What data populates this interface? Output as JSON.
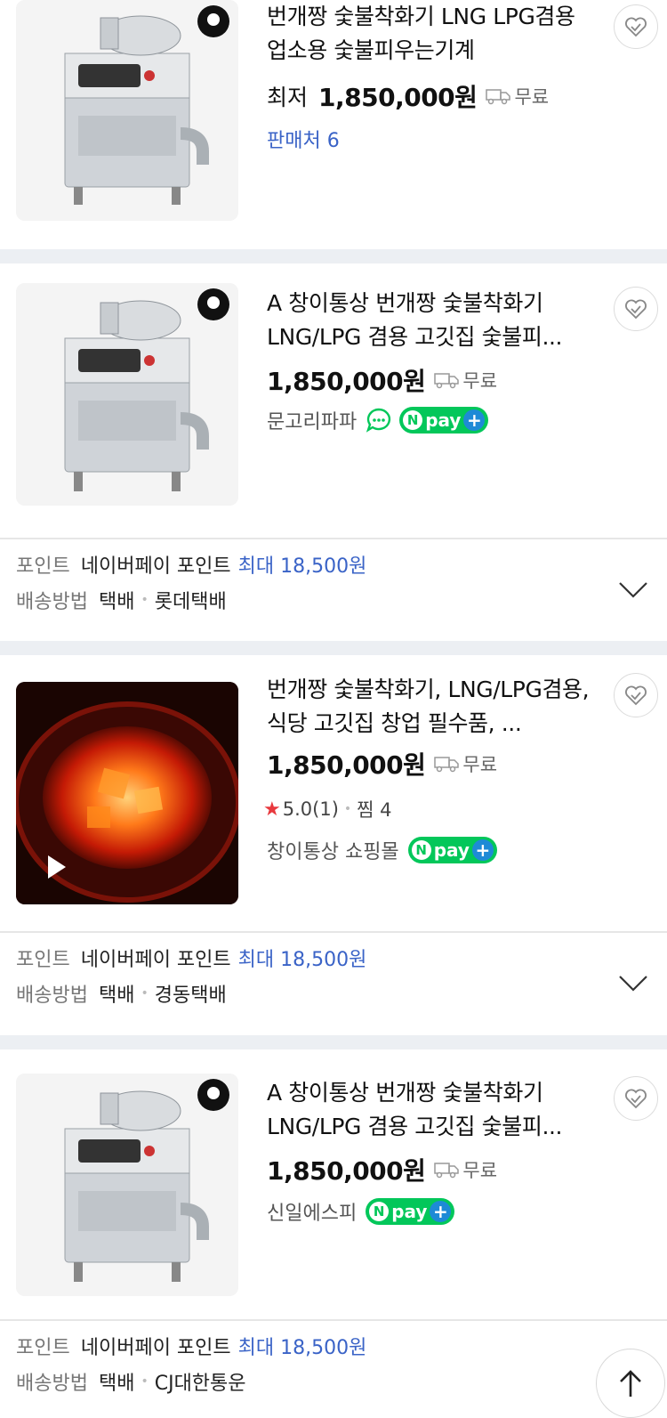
{
  "products": [
    {
      "title": "번개짱 숯불착화기 LNG LPG겸용 업소용 숯불피우는기계",
      "price_prefix": "최저",
      "price": "1,850,000원",
      "shipping": "무료",
      "seller_link": "판매처 6"
    },
    {
      "title": "A 창이통상 번개짱 숯불착화기 LNG/LPG 겸용 고깃집 숯불피...",
      "price": "1,850,000원",
      "shipping": "무료",
      "seller": "문고리파파",
      "npay": "pay"
    },
    {
      "title": "번개짱 숯불착화기, LNG/LPG겸용, 식당 고깃집 창업 필수품, ...",
      "price": "1,850,000원",
      "shipping": "무료",
      "rating": "5.0",
      "review_count": "(1)",
      "zzim": "찜 4",
      "seller": "창이통상 쇼핑몰",
      "npay": "pay"
    },
    {
      "title": "A 창이통상 번개짱 숯불착화기 LNG/LPG 겸용 고깃집 숯불피...",
      "price": "1,850,000원",
      "shipping": "무료",
      "seller": "신일에스피",
      "npay": "pay"
    }
  ],
  "info_blocks": [
    {
      "point_label": "포인트",
      "point_value": "네이버페이 포인트",
      "point_max": "최대 18,500원",
      "delivery_label": "배송방법",
      "delivery_method": "택배",
      "courier": "롯데택배"
    },
    {
      "point_label": "포인트",
      "point_value": "네이버페이 포인트",
      "point_max": "최대 18,500원",
      "delivery_label": "배송방법",
      "delivery_method": "택배",
      "courier": "경동택배"
    },
    {
      "point_label": "포인트",
      "point_value": "네이버페이 포인트",
      "point_max": "최대 18,500원",
      "delivery_label": "배송방법",
      "delivery_method": "택배",
      "courier": "CJ대한통운"
    }
  ],
  "colors": {
    "accent_blue": "#3a63c7",
    "npay_green": "#03c75a",
    "star_red": "#e8383d"
  },
  "icons": [
    "heart-check-icon",
    "truck-icon",
    "chat-icon",
    "npay-icon",
    "chevron-down-icon",
    "play-icon",
    "arrow-up-icon"
  ]
}
